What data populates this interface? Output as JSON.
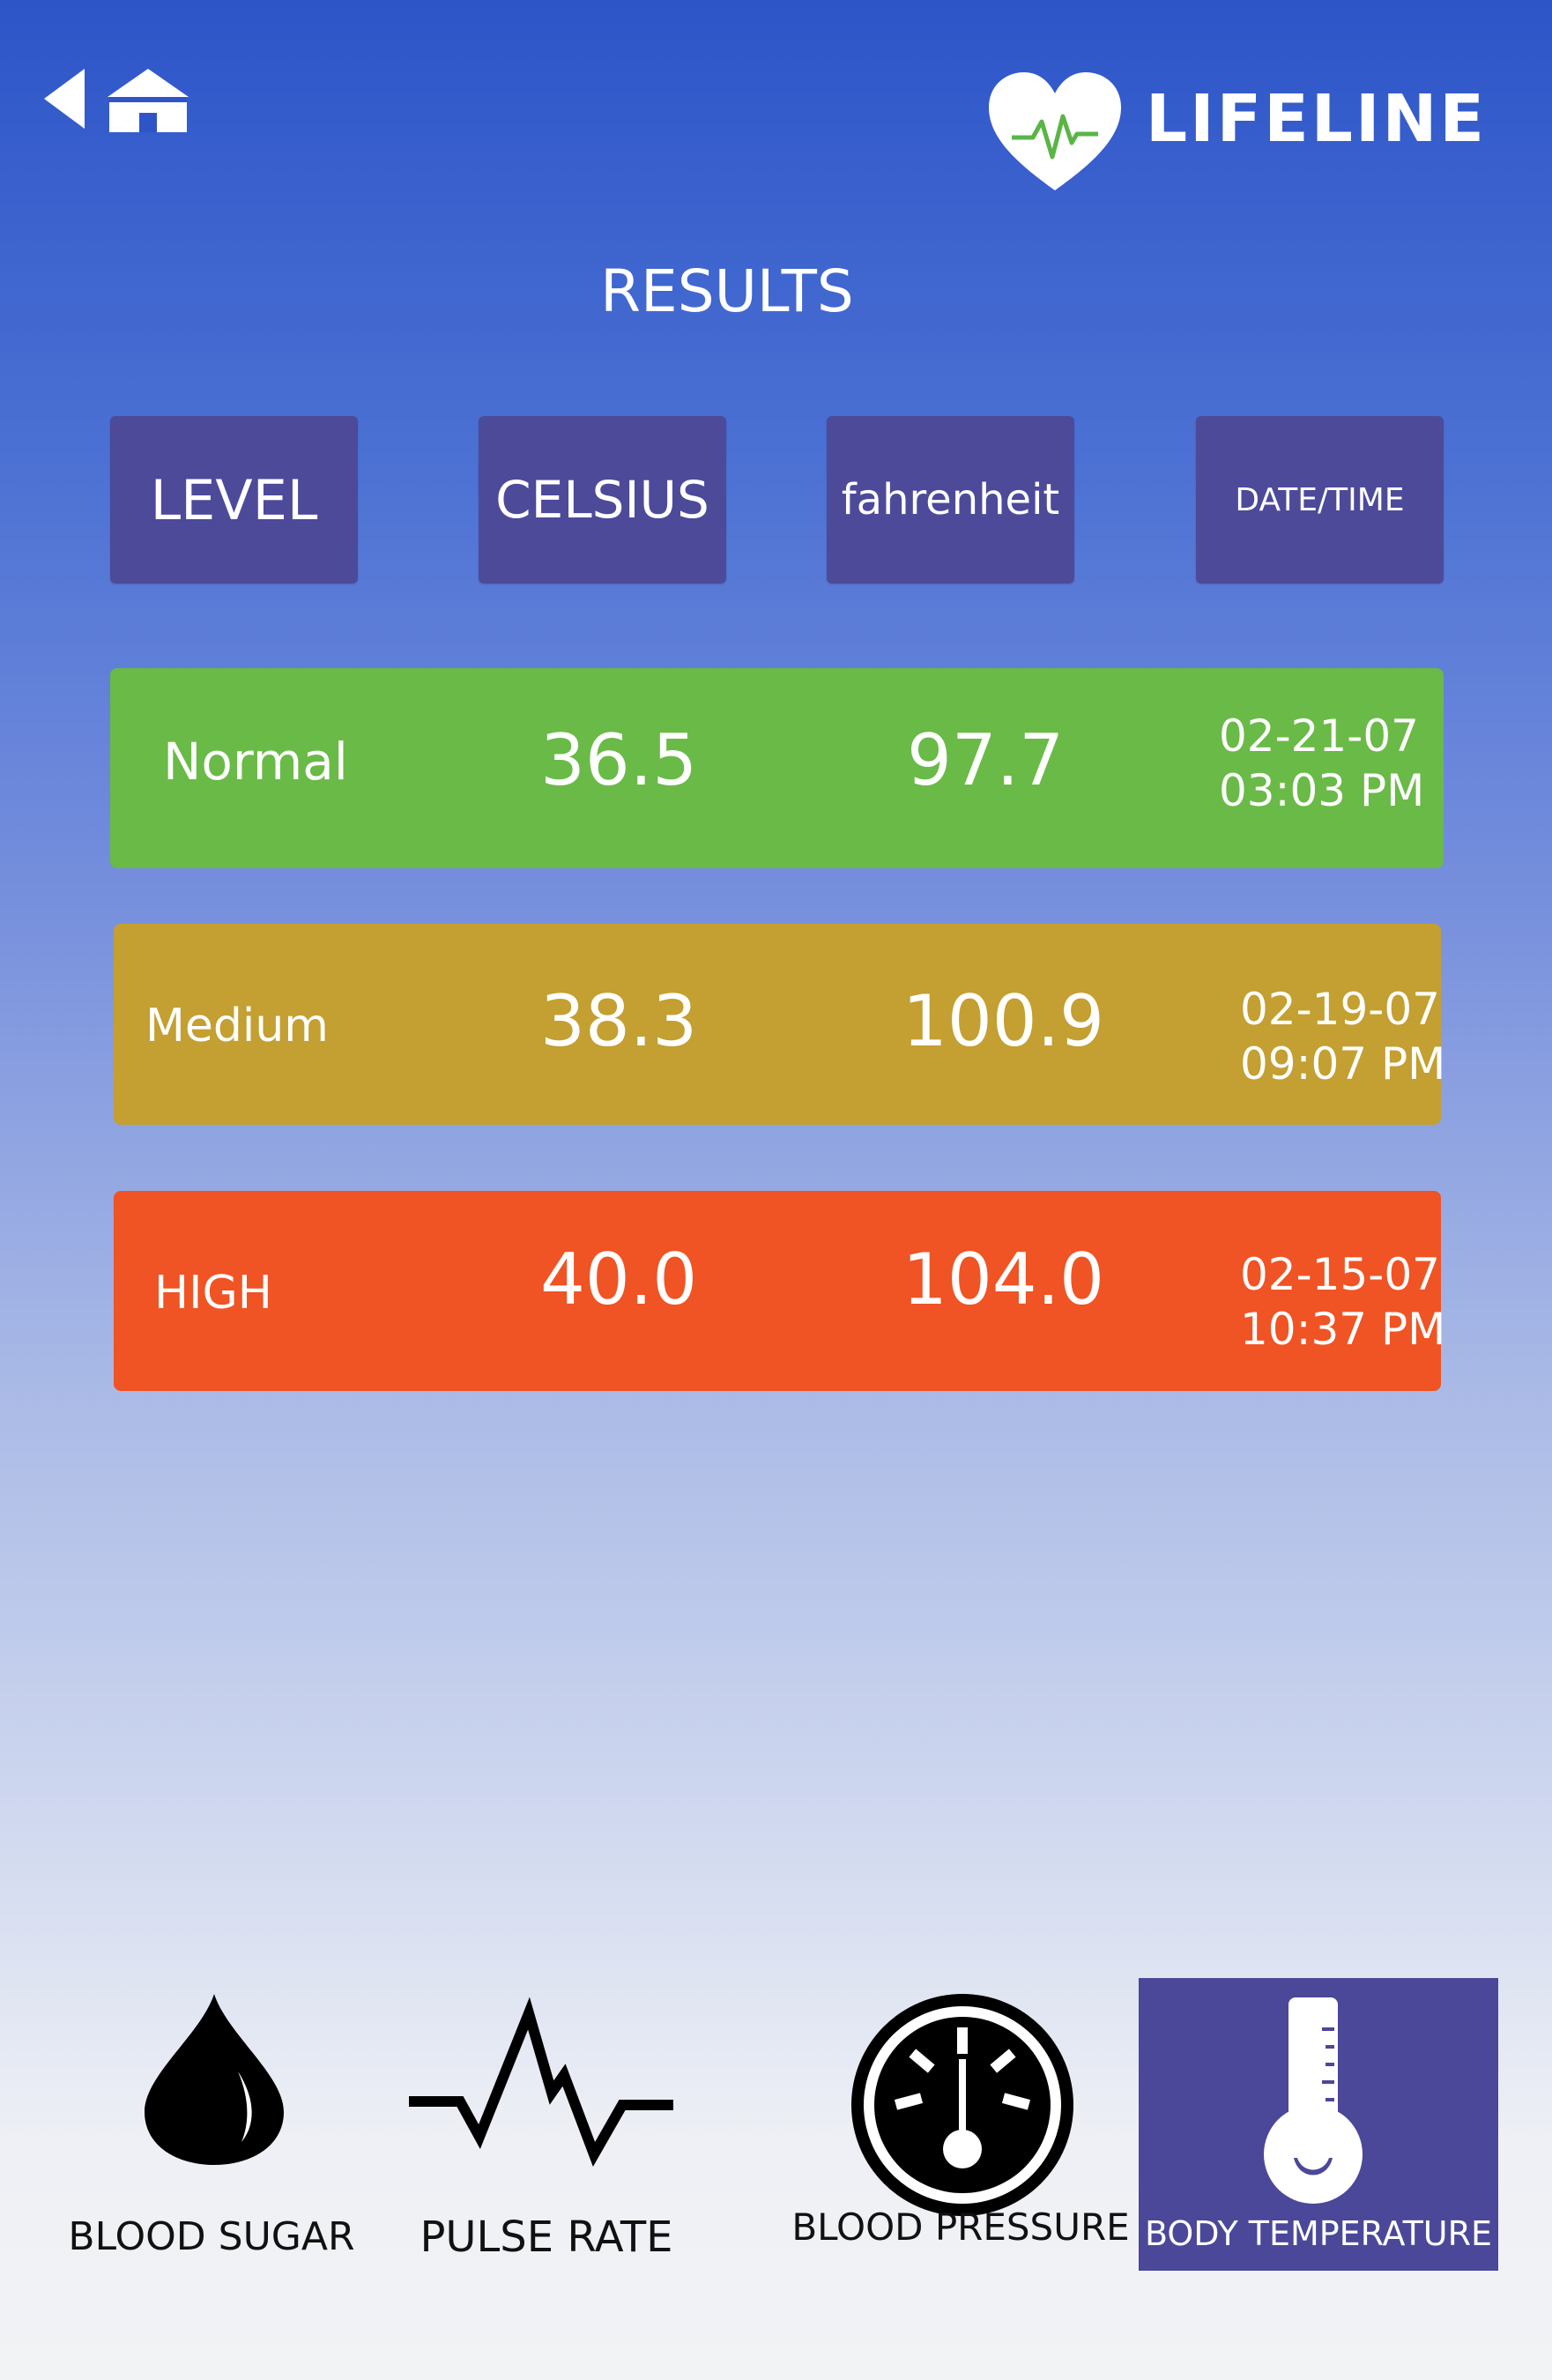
{
  "app": {
    "name": "LIFELINE"
  },
  "page": {
    "title": "RESULTS"
  },
  "colors": {
    "header_cell": "#4d4a9a",
    "normal": "#6aba47",
    "medium": "#c49f31",
    "high": "#f05324",
    "nav_active": "#4b4799"
  },
  "table": {
    "headers": [
      "LEVEL",
      "CELSIUS",
      "fahrenheit",
      "DATE/TIME"
    ],
    "rows": [
      {
        "level": "Normal",
        "celsius": "36.5",
        "fahrenheit": "97.7",
        "date": "02-21-07",
        "time": "03:03 PM"
      },
      {
        "level": "Medium",
        "celsius": "38.3",
        "fahrenheit": "100.9",
        "date": "02-19-07",
        "time": "09:07 PM"
      },
      {
        "level": "HIGH",
        "celsius": "40.0",
        "fahrenheit": "104.0",
        "date": "02-15-07",
        "time": "10:37 PM"
      }
    ]
  },
  "nav": {
    "items": [
      {
        "label": "BLOOD SUGAR",
        "icon": "drop-icon"
      },
      {
        "label": "PULSE RATE",
        "icon": "pulse-icon"
      },
      {
        "label": "BLOOD PRESSURE",
        "icon": "gauge-icon"
      },
      {
        "label": "BODY TEMPERATURE",
        "icon": "thermometer-icon",
        "active": true
      }
    ]
  }
}
